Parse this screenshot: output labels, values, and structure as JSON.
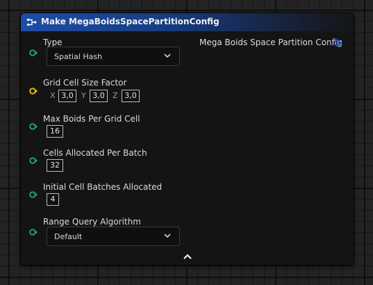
{
  "node": {
    "title": "Make MegaBoidsSpacePartitionConfig",
    "output_pin_label": "Mega Boids Space Partition Config"
  },
  "pins": {
    "type": {
      "label": "Type",
      "value": "Spatial Hash"
    },
    "grid_cell_size_factor": {
      "label": "Grid Cell Size Factor",
      "x_label": "X",
      "x_value": "3,0",
      "y_label": "Y",
      "y_value": "3,0",
      "z_label": "Z",
      "z_value": "3,0"
    },
    "max_boids_per_grid_cell": {
      "label": "Max Boids Per Grid Cell",
      "value": "16"
    },
    "cells_allocated_per_batch": {
      "label": "Cells Allocated Per Batch",
      "value": "32"
    },
    "initial_cell_batches_allocated": {
      "label": "Initial Cell Batches Allocated",
      "value": "4"
    },
    "range_query_algorithm": {
      "label": "Range Query Algorithm",
      "value": "Default"
    }
  },
  "colors": {
    "header_blue": "#1d4da6",
    "struct_pin_teal": "#1e9b8a",
    "vector_pin_gold": "#e6b800",
    "output_pin_blue": "#1f5fd6"
  },
  "icons": {
    "header": "make-struct-icon",
    "dropdown": "chevron-down-icon",
    "collapse": "chevron-up-icon"
  }
}
